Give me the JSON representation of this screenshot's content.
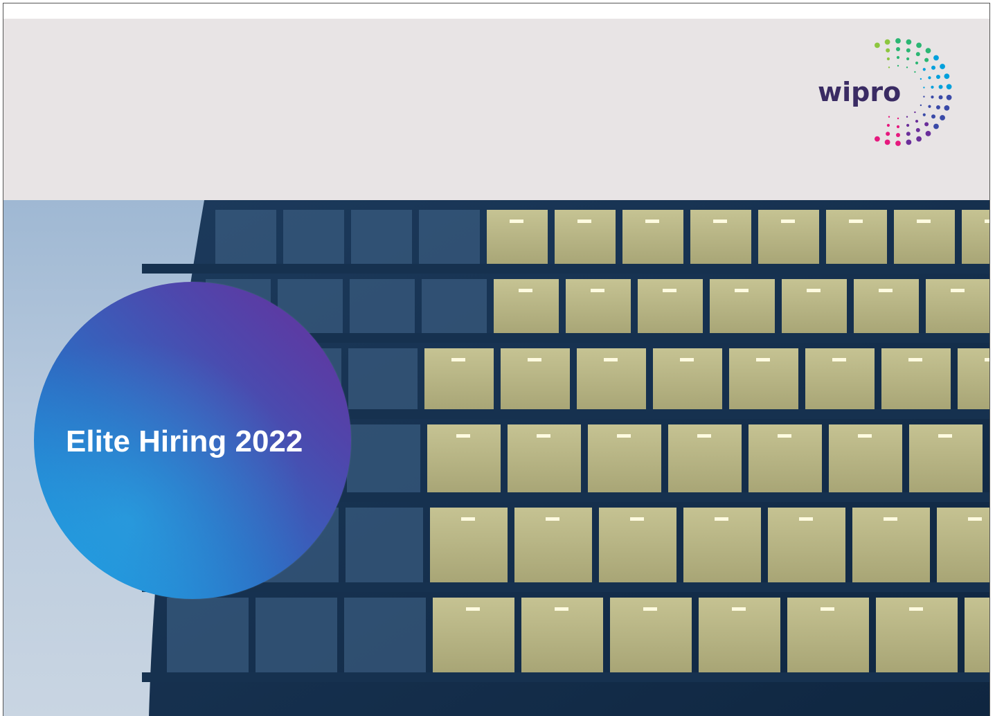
{
  "brand": {
    "logo_text": "wipro",
    "logo_dot_colors": [
      "#2bb673",
      "#00a0dc",
      "#3a4aa8",
      "#6a2e9a",
      "#e6197e",
      "#f68b1f",
      "#ffd200",
      "#8dc63f"
    ]
  },
  "hero": {
    "title": "Elite Hiring 2022"
  },
  "colors": {
    "header_bg": "#e8e4e5",
    "circle_gradient_start": "#6a2e9a",
    "circle_gradient_end": "#1a9ae0",
    "title_color": "#ffffff"
  }
}
